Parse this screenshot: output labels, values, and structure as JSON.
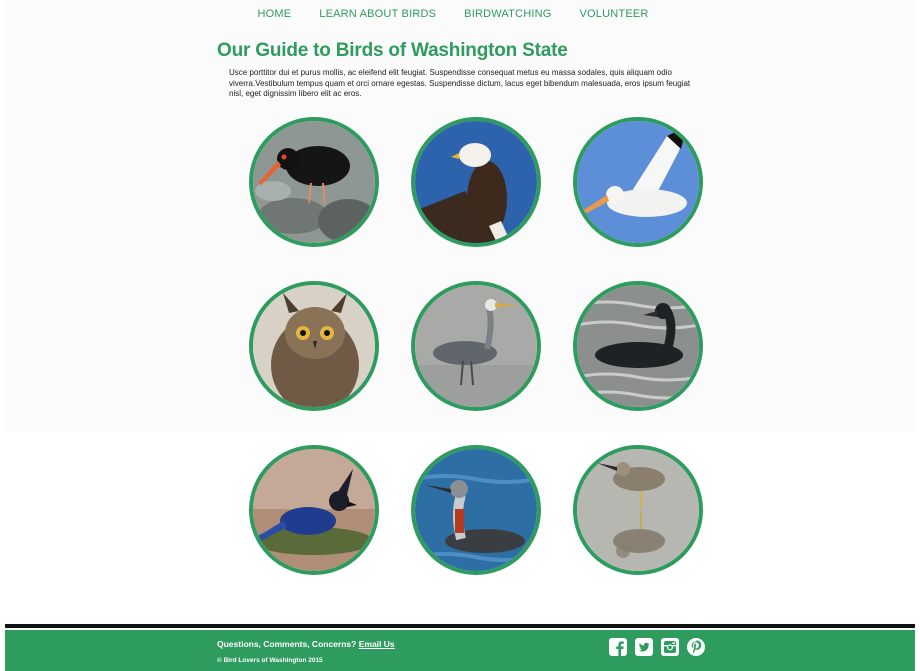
{
  "nav": {
    "items": [
      "HOME",
      "LEARN ABOUT BIRDS",
      "BIRDWATCHING",
      "VOLUNTEER"
    ]
  },
  "page": {
    "title": "Our Guide to Birds of Washington State",
    "intro": "Usce porttitor dui et purus mollis, ac eleifend elit feugiat. Suspendisse consequat metus eu massa sodales, quis aliquam odio viverra.Vestibulum tempus quam et orci ornare egestas. Suspendisse dictum, lacus eget bibendum malesuada, eros ipsum feugiat nisl, eget dignissim libero elit ac eros."
  },
  "birds": [
    {
      "name": "black-oystercatcher"
    },
    {
      "name": "bald-eagle"
    },
    {
      "name": "american-white-pelican"
    },
    {
      "name": "great-horned-owl"
    },
    {
      "name": "great-blue-heron"
    },
    {
      "name": "cormorant"
    },
    {
      "name": "stellers-jay"
    },
    {
      "name": "red-throated-loon"
    },
    {
      "name": "greater-yellowlegs"
    }
  ],
  "footer": {
    "question": "Questions, Comments, Concerns?",
    "email_link": "Email Us",
    "copyright": "© Bird Lovers of Washington 2015",
    "social_icons": [
      "facebook-icon",
      "twitter-icon",
      "instagram-icon",
      "pinterest-icon"
    ]
  },
  "colors": {
    "accent": "#2e9b5f",
    "footer_bg": "#2e9b5f",
    "divider": "#111111"
  }
}
